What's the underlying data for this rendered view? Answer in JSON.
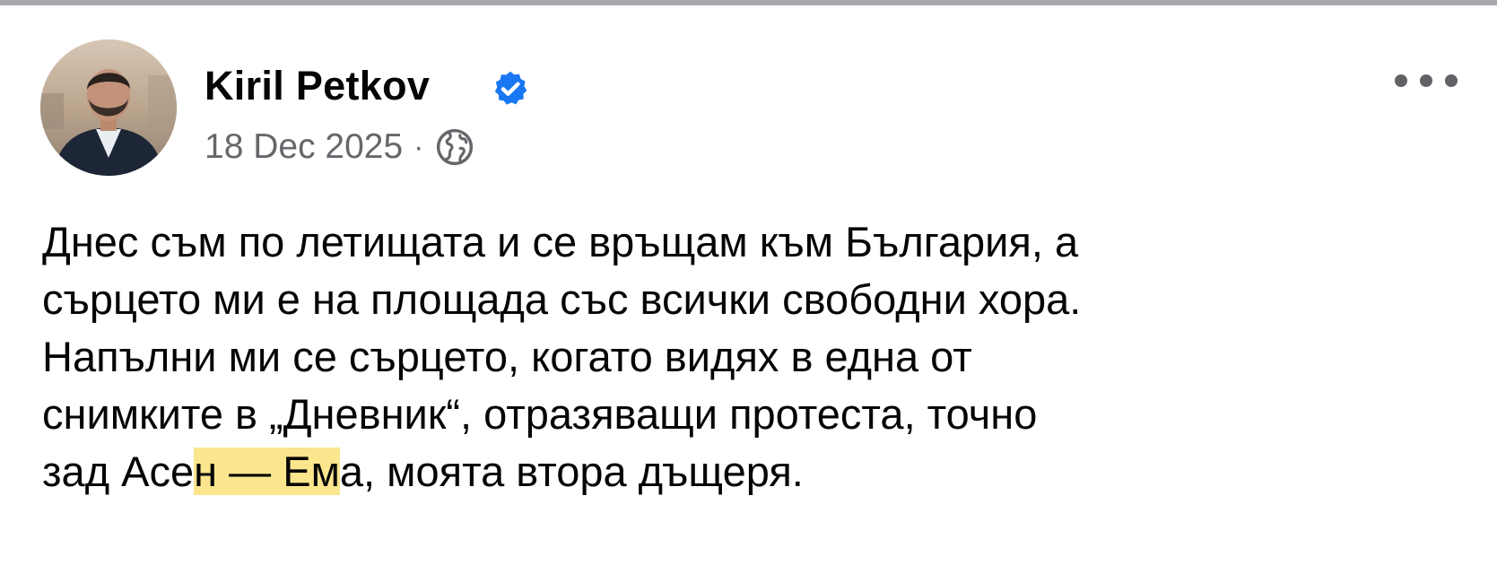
{
  "post": {
    "author": {
      "name": "Kiril Petkov",
      "verified": true,
      "avatar_icon": "profile-photo"
    },
    "meta": {
      "date": "18 Dec 2025",
      "separator": "·",
      "audience_icon": "globe-icon"
    },
    "more_icon": "more-horizontal-icon",
    "text_lines": [
      {
        "before": "Днес съм по летищата и се връщам към България, а",
        "highlight": "",
        "after": ""
      },
      {
        "before": "сърцето ми е на площада със всички свободни хора.",
        "highlight": "",
        "after": ""
      },
      {
        "before": "Напълни ми се сърцето, когато видях в една от",
        "highlight": "",
        "after": ""
      },
      {
        "before": "снимките в „Дневник“, отразяващи протеста, точно",
        "highlight": "",
        "after": ""
      },
      {
        "before": "зад Асе",
        "highlight": "н — Ем",
        "after": "а, моята втора дъщеря."
      }
    ]
  },
  "colors": {
    "verified_badge": "#1877f2",
    "secondary_text": "#65676b",
    "highlight": "#fbe68e",
    "top_border": "#a7a9ad"
  }
}
